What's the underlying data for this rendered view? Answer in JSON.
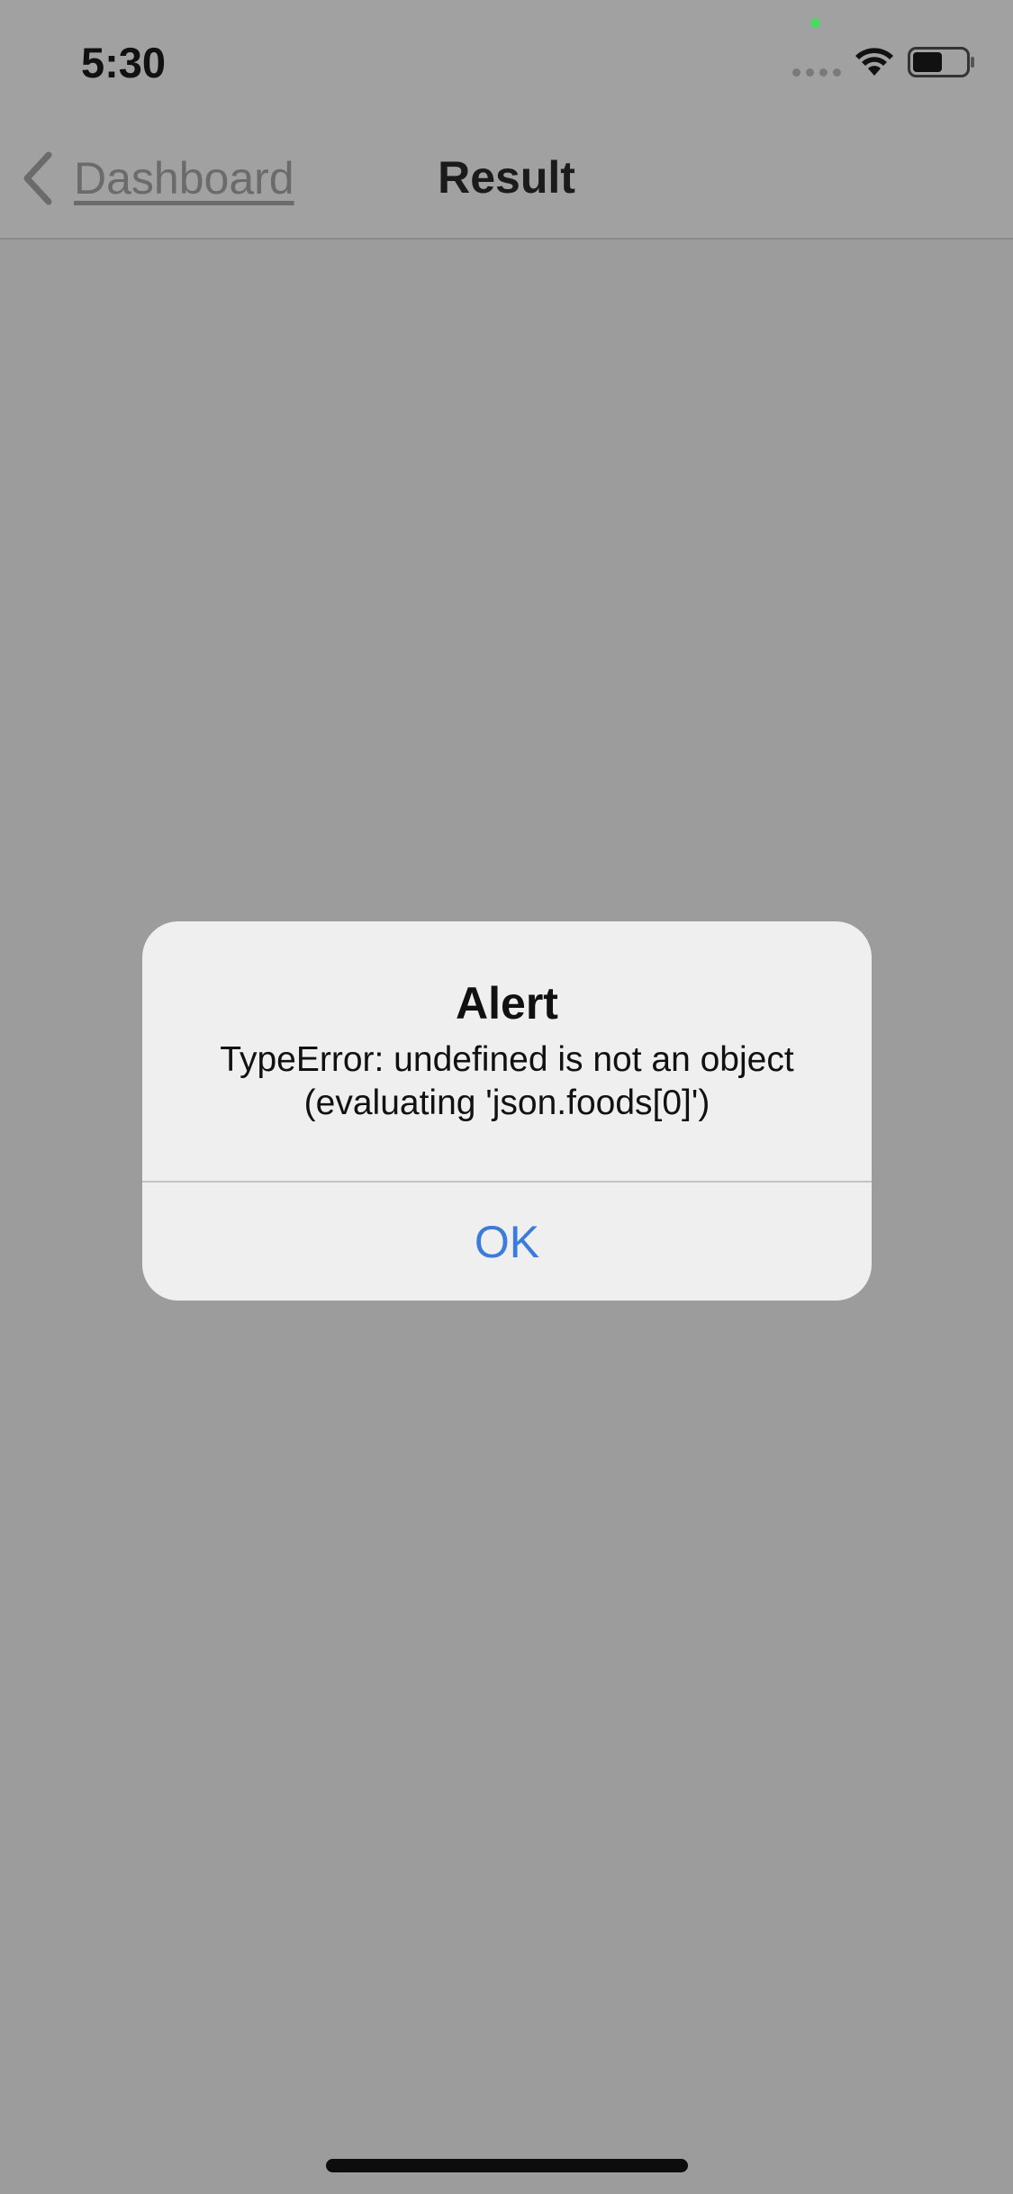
{
  "status_bar": {
    "time": "5:30",
    "icons": [
      "signal-icon",
      "wifi-icon",
      "battery-icon"
    ]
  },
  "nav": {
    "back_label": "Dashboard",
    "back_icon": "chevron-left-icon",
    "title": "Result"
  },
  "alert": {
    "title": "Alert",
    "message": "TypeError: undefined is not an object (evaluating 'json.foods[0]')",
    "ok_label": "OK"
  },
  "colors": {
    "overlay_bg": "#9c9c9c",
    "alert_bg": "#efefef",
    "accent": "#3a7bdc",
    "status_green": "#4cd964"
  }
}
